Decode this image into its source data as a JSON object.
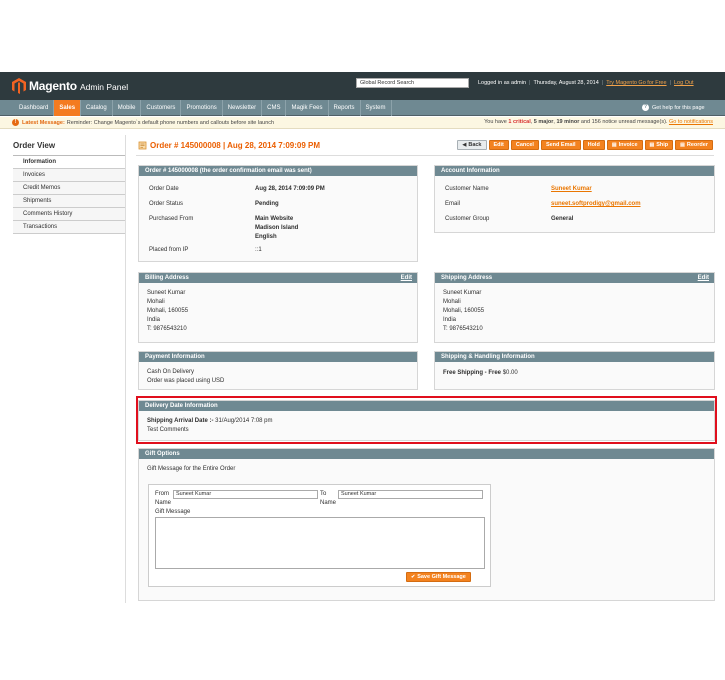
{
  "header": {
    "brand": "Magento",
    "subtitle": "Admin Panel",
    "search_value": "Global Record Search",
    "logged_in": "Logged in as admin",
    "date": "Thursday, August 28, 2014",
    "try_link": "Try Magento Go for Free",
    "logout": "Log Out"
  },
  "nav": {
    "items": [
      "Dashboard",
      "Sales",
      "Catalog",
      "Mobile",
      "Customers",
      "Promotions",
      "Newsletter",
      "CMS",
      "Magik Fees",
      "Reports",
      "System"
    ],
    "help": "Get help for this page"
  },
  "message": {
    "label": "Latest Message:",
    "text": "Reminder: Change Magento`s default phone numbers and callouts before site launch",
    "right_pre": "You have",
    "critical": "1 critical",
    "major": "5 major",
    "minor": "19 minor",
    "notice": "156 notice unread message(s).",
    "link": "Go to notifications"
  },
  "sidebar": {
    "title": "Order View",
    "tabs": [
      "Information",
      "Invoices",
      "Credit Memos",
      "Shipments",
      "Comments History",
      "Transactions"
    ]
  },
  "page": {
    "title": "Order # 145000008 | Aug 28, 2014 7:09:09 PM",
    "actions": [
      "Back",
      "Edit",
      "Cancel",
      "Send Email",
      "Hold",
      "Invoice",
      "Ship",
      "Reorder"
    ]
  },
  "order": {
    "head": "Order # 145000008 (the order confirmation email was sent)",
    "date_label": "Order Date",
    "date": "Aug 28, 2014 7:09:09 PM",
    "status_label": "Order Status",
    "status": "Pending",
    "purchased_label": "Purchased From",
    "purchased": [
      "Main Website",
      "Madison Island",
      "English"
    ],
    "ip_label": "Placed from IP",
    "ip": "::1"
  },
  "account": {
    "head": "Account Information",
    "name_label": "Customer Name",
    "name": "Suneet Kumar",
    "email_label": "Email",
    "email": "suneet.softprodigy@gmail.com",
    "group_label": "Customer Group",
    "group": "General"
  },
  "billing": {
    "head": "Billing Address",
    "edit": "Edit",
    "lines": [
      "Suneet Kumar",
      "Mohali",
      "Mohali, 160055",
      "India",
      "T: 9876543210"
    ]
  },
  "shipping": {
    "head": "Shipping Address",
    "edit": "Edit",
    "lines": [
      "Suneet Kumar",
      "Mohali",
      "Mohali, 160055",
      "India",
      "T: 9876543210"
    ]
  },
  "payment": {
    "head": "Payment Information",
    "lines": [
      "Cash On Delivery",
      "Order was placed using USD"
    ]
  },
  "handling": {
    "head": "Shipping & Handling Information",
    "method": "Free Shipping - Free",
    "price": "$0.00"
  },
  "delivery": {
    "head": "Delivery Date Information",
    "label": "Shipping Arrival Date :-",
    "value": "31/Aug/2014 7:08 pm",
    "comments": "Test Comments"
  },
  "gift": {
    "head": "Gift Options",
    "subtitle": "Gift Message for the Entire Order",
    "from_label": "From",
    "from_value": "Suneet Kumar",
    "to_label": "To",
    "to_value": "Suneet Kumar",
    "name_label": "Name",
    "message_label": "Gift Message",
    "save": "Save Gift Message"
  }
}
